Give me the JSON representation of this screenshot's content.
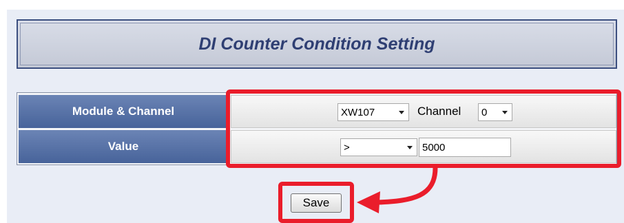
{
  "title": "DI Counter Condition Setting",
  "rows": {
    "module": {
      "label": "Module & Channel",
      "module_value": "XW107",
      "channel_label": "Channel",
      "channel_value": "0"
    },
    "value": {
      "label": "Value",
      "operator": ">",
      "amount": "5000"
    }
  },
  "save_label": "Save",
  "colors": {
    "highlight": "#ea1d2b",
    "label_bg": "#47639a",
    "title_text": "#2f3f73",
    "panel_bg": "#e9edf6"
  },
  "icons": [
    "dropdown-arrow-icon",
    "pointer-arrow-icon"
  ]
}
